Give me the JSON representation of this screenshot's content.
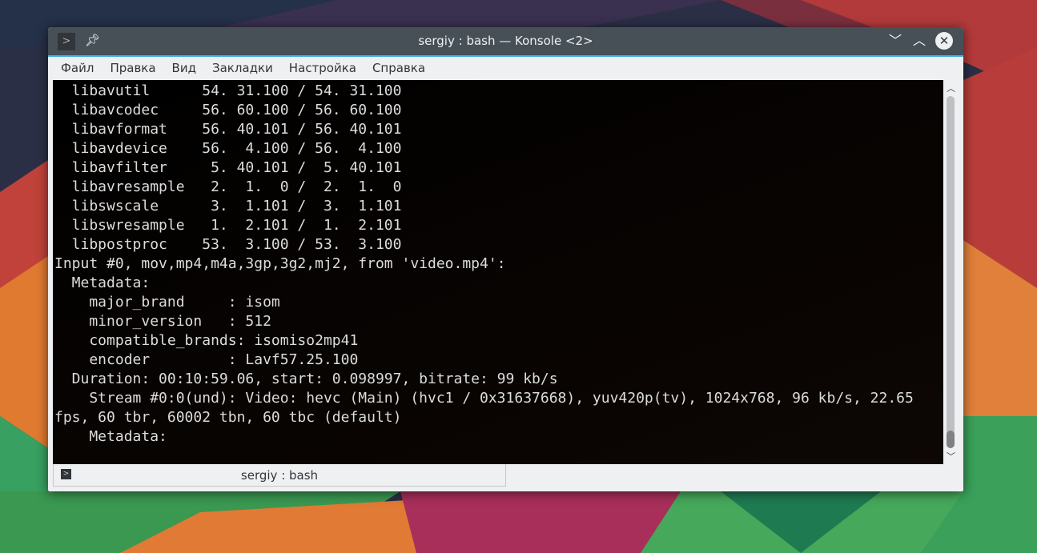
{
  "window": {
    "title": "sergiy : bash — Konsole <2>"
  },
  "titlebar_icons": {
    "menu": "terminal-icon",
    "pin": "pin-icon",
    "minimize": "chevron-down-icon",
    "maximize": "chevron-up-icon",
    "close": "close-icon"
  },
  "menu": [
    "Файл",
    "Правка",
    "Вид",
    "Закладки",
    "Настройка",
    "Справка"
  ],
  "terminal": {
    "lines": [
      "  libavutil      54. 31.100 / 54. 31.100",
      "  libavcodec     56. 60.100 / 56. 60.100",
      "  libavformat    56. 40.101 / 56. 40.101",
      "  libavdevice    56.  4.100 / 56.  4.100",
      "  libavfilter     5. 40.101 /  5. 40.101",
      "  libavresample   2.  1.  0 /  2.  1.  0",
      "  libswscale      3.  1.101 /  3.  1.101",
      "  libswresample   1.  2.101 /  1.  2.101",
      "  libpostproc    53.  3.100 / 53.  3.100",
      "Input #0, mov,mp4,m4a,3gp,3g2,mj2, from 'video.mp4':",
      "  Metadata:",
      "    major_brand     : isom",
      "    minor_version   : 512",
      "    compatible_brands: isomiso2mp41",
      "    encoder         : Lavf57.25.100",
      "  Duration: 00:10:59.06, start: 0.098997, bitrate: 99 kb/s",
      "    Stream #0:0(und): Video: hevc (Main) (hvc1 / 0x31637668), yuv420p(tv), 1024x768, 96 kb/s, 22.65",
      "fps, 60 tbr, 60002 tbn, 60 tbc (default)",
      "    Metadata:"
    ]
  },
  "scrollbar": {
    "position": 1.0
  },
  "tab": {
    "label": "sergiy : bash"
  },
  "colors": {
    "accent": "#3daee9",
    "titlebar": "#475057"
  }
}
